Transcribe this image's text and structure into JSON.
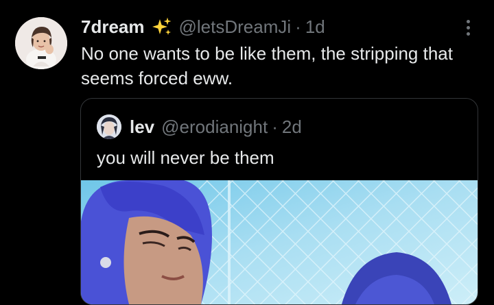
{
  "tweet": {
    "display_name": "7dream",
    "handle": "@letsDreamJi",
    "separator": "·",
    "time": "1d",
    "text": "No one wants to be like them, the stripping that seems forced eww.",
    "emoji": "sparkles-icon"
  },
  "quoted": {
    "display_name": "lev",
    "handle": "@erodianight",
    "separator": "·",
    "time": "2d",
    "text": "you will never be them"
  },
  "colors": {
    "background": "#000000",
    "primary_text": "#e7e9ea",
    "secondary_text": "#71767b",
    "border": "#333639",
    "sparkle": "#ffd43b"
  }
}
